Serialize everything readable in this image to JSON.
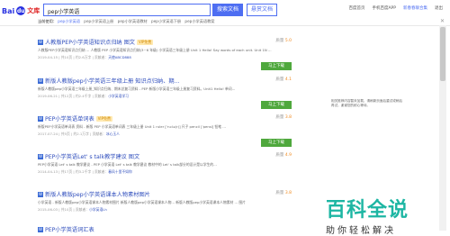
{
  "header": {
    "logo_text": "Bai",
    "logo_paw": "du",
    "logo_sub": "文库",
    "search_value": "pep小学英语",
    "search_button": "搜索文档",
    "upload_button": "悬赏文档",
    "links": [
      "百度首页",
      "手机百度APP",
      "新春春联合集",
      "退出"
    ],
    "close_symbol": "✕"
  },
  "nav": {
    "label": "当前使用：",
    "items": [
      "pep小学英语",
      "pep小学英语上册",
      "pep小学英语教材",
      "pep小学英语下册",
      "pep小学英语教案"
    ]
  },
  "results": [
    {
      "title": "人教版PEP小学英语知识点归纳 图文",
      "badge": "VIP免费",
      "rating_label": "质量 ",
      "rating": "5.0",
      "desc": "人教版PEP小学英语知识点归纳 ... 人教版 PEP 小学英语知识点归纳(3~6 年级) 小学英语三年级上册 Unit 1 Hello! Say words of each unit. Unit 1N ...",
      "meta": "2019-04-15 | 共10页 | 约2.6万字 | 贡献者：",
      "contributor": "天使ABCD888",
      "button": "马上下载"
    },
    {
      "title": "新版人教版pep小学英语三年级上册 知识点归纳、期...",
      "badge": "",
      "rating_label": "质量 ",
      "rating": "4.1",
      "desc": "新版人教版pep小学英语三年级上册_知识点归纳、期末总复习资料 - PEP 新版小学英语三年级上册复习资料。Unit1 Hello! 单词... ",
      "meta": "2019-06-21 | 共12页 | 约2.4千字 | 贡献者：",
      "contributor": "小学英语学习",
      "button": "马上下载"
    },
    {
      "title": "PEP小学英语单词表",
      "badge": "VIP免费",
      "rating_label": "质量 ",
      "rating": "3.8",
      "desc": "新版PEP小学英语单词表 资料 - 新版 PEP 小学英语单词表 三年级上册 Unit 1 ruler [ˈruːlə(r)] 尺子 pencil [ˈpensl] 铅笔 ...",
      "meta": "2017-07-24 | 共5页 | 约2.1万字 | 贡献者：",
      "contributor": "冰心玉人",
      "button": "马上下载"
    },
    {
      "title": "PEP小学英语Let' s talk教学建议 图文",
      "badge": "",
      "rating_label": "质量 ",
      "rating": "4.9",
      "desc": "PEP小学英语 Let' s talk 教学建议 - PEP 小学英语 Let' s talk 教学建议 教材中的 Let' s talk部分的设计是以学生的...",
      "meta": "2014-04-13 | 共17页 | 约3.2千字 | 贡献者：",
      "contributor": "春风十里不如你",
      "button": ""
    },
    {
      "title": "新版人教版pep小学英语课本人物素材图片",
      "badge": "",
      "rating_label": "质量 ",
      "rating": "3.8",
      "desc": "小学英语 - 新版人教版pep小学英语课本人物素材图片 新版人教版pep小学英语课本人物... 新版人教版pep小学英语课本人物素材 ... 图片",
      "meta": "2015-06-03 | 共10页 | 贡献者：",
      "contributor": "小学英语Lh",
      "button": ""
    },
    {
      "title": "PEP小学英语词汇表",
      "badge": "",
      "rating_label": "质量 ",
      "rating": "",
      "desc": "",
      "meta": "",
      "contributor": "",
      "button": ""
    }
  ],
  "side": {
    "notice": "相关推荐内容暂未加载，请刷新页面后重试或稍后再试，谢谢您的耐心等待。"
  },
  "watermark": {
    "main": "百科全说",
    "sub": "助你轻松解决"
  }
}
